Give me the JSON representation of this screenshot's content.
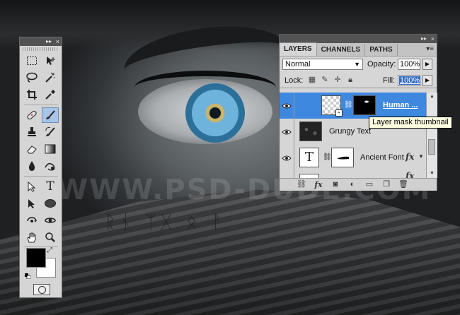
{
  "background": {
    "watermark": "WWW.PSD-DUDE.COM"
  },
  "tools_panel": {
    "collapse_icon": "double-arrow-icon",
    "close_icon": "close-icon",
    "tools": [
      {
        "name": "rectangular-marquee",
        "icon": "marquee-icon"
      },
      {
        "name": "move",
        "icon": "move-icon"
      },
      {
        "name": "lasso",
        "icon": "lasso-icon"
      },
      {
        "name": "magic-wand",
        "icon": "magic-wand-icon"
      },
      {
        "name": "crop",
        "icon": "crop-icon"
      },
      {
        "name": "eyedropper",
        "icon": "eyedropper-icon"
      },
      {
        "name": "healing-brush",
        "icon": "bandage-icon"
      },
      {
        "name": "brush",
        "icon": "brush-icon",
        "selected": true
      },
      {
        "name": "clone-stamp",
        "icon": "stamp-icon"
      },
      {
        "name": "history-brush",
        "icon": "history-brush-icon"
      },
      {
        "name": "eraser",
        "icon": "eraser-icon"
      },
      {
        "name": "gradient",
        "icon": "gradient-icon"
      },
      {
        "name": "blur",
        "icon": "drop-icon"
      },
      {
        "name": "dodge",
        "icon": "dodge-icon"
      },
      {
        "name": "path-selection",
        "icon": "path-arrow-icon"
      },
      {
        "name": "type",
        "icon": "type-icon",
        "glyph": "T"
      },
      {
        "name": "direct-selection",
        "icon": "direct-arrow-icon"
      },
      {
        "name": "ellipse",
        "icon": "ellipse-icon"
      },
      {
        "name": "3d-rotate",
        "icon": "rotate-3d-icon"
      },
      {
        "name": "3d-orbit",
        "icon": "orbit-3d-icon"
      },
      {
        "name": "hand",
        "icon": "hand-icon"
      },
      {
        "name": "zoom",
        "icon": "zoom-icon"
      }
    ],
    "foreground_color": "#000000",
    "background_color": "#ffffff"
  },
  "layers_panel": {
    "tabs": [
      {
        "label": "LAYERS",
        "active": true
      },
      {
        "label": "CHANNELS",
        "active": false
      },
      {
        "label": "PATHS",
        "active": false
      }
    ],
    "blend_mode": "Normal",
    "opacity_label": "Opacity:",
    "opacity_value": "100%",
    "lock_label": "Lock:",
    "fill_label": "Fill:",
    "fill_value": "100%",
    "layers": [
      {
        "name": "Human ...",
        "selected": true,
        "thumb": "checker",
        "mask": "black",
        "linked": true
      },
      {
        "name": "Grungy Text",
        "selected": false,
        "thumb": "grunge"
      },
      {
        "name": "Ancient Font",
        "selected": false,
        "thumb": "type",
        "thumb_glyph": "T",
        "mask": "white",
        "linked": true,
        "fx": "fx"
      },
      {
        "name": "",
        "selected": false,
        "thumb": "type",
        "thumb_glyph": "T",
        "fx": "fx"
      }
    ],
    "tooltip": "Layer mask thumbnail"
  }
}
